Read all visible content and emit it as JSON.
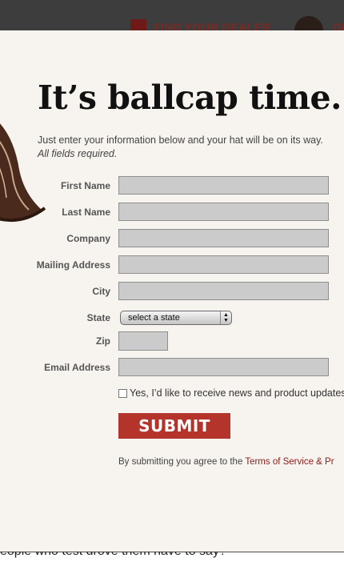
{
  "header": {
    "dealer_label": "FIND YOUR DEALER",
    "cut_label": "GE"
  },
  "modal": {
    "headline": "It’s ballcap time.",
    "intro": "Just enter your information below and your hat will be on its way.",
    "required_note": "All fields required.",
    "fields": {
      "first_name": "First Name",
      "last_name": "Last Name",
      "company": "Company",
      "mailing_address": "Mailing Address",
      "city": "City",
      "state": "State",
      "zip": "Zip",
      "email": "Email Address"
    },
    "state_select": "select a state",
    "checkbox_label": "Yes, I’d like to receive news and product updates f",
    "submit_label": "SUBMIT",
    "terms_prefix": "By submitting you agree to the ",
    "terms_link": "Terms of Service & Pr"
  },
  "background": {
    "bottom_text": "eople who test drove them have to say?"
  }
}
